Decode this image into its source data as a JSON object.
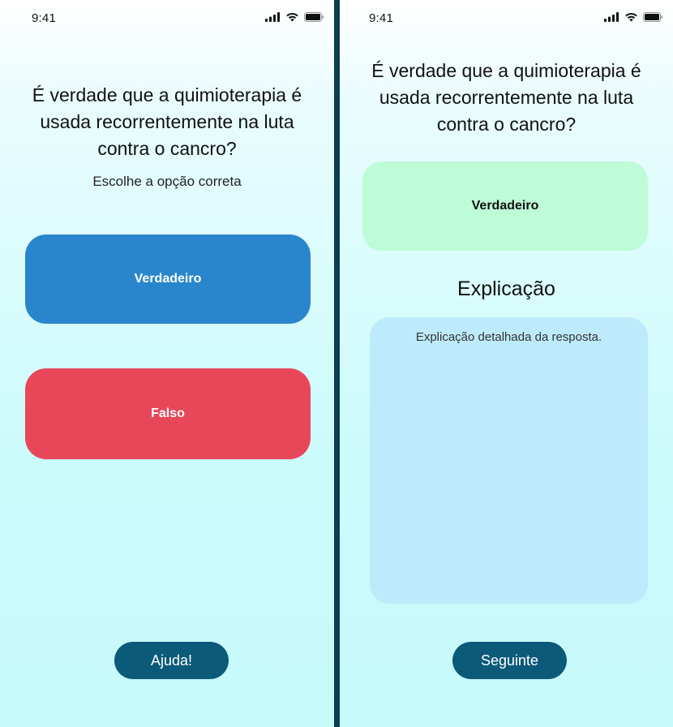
{
  "colors": {
    "divider": "#0c3d50",
    "true_button": "#2a86cc",
    "false_button": "#e8475a",
    "selected_answer": "#bdfcd7",
    "explanation_box": "#bdebfb",
    "bottom_button": "#0c5a7a"
  },
  "left_screen": {
    "status": {
      "time": "9:41",
      "icons": [
        "cellular-signal-icon",
        "wifi-icon",
        "battery-icon"
      ]
    },
    "question": "É verdade que a quimioterapia é usada recorrentemente na luta contra o cancro?",
    "instruction": "Escolhe a opção correta",
    "options": [
      {
        "label": "Verdadeiro"
      },
      {
        "label": "Falso"
      }
    ],
    "help_button": "Ajuda!"
  },
  "right_screen": {
    "status": {
      "time": "9:41",
      "icons": [
        "cellular-signal-icon",
        "wifi-icon",
        "battery-icon"
      ]
    },
    "question": "É verdade que a quimioterapia é usada recorrentemente na luta contra o cancro?",
    "selected_answer": "Verdadeiro",
    "explanation_title": "Explicação",
    "explanation_text": "Explicação detalhada da resposta.",
    "next_button": "Seguinte"
  }
}
